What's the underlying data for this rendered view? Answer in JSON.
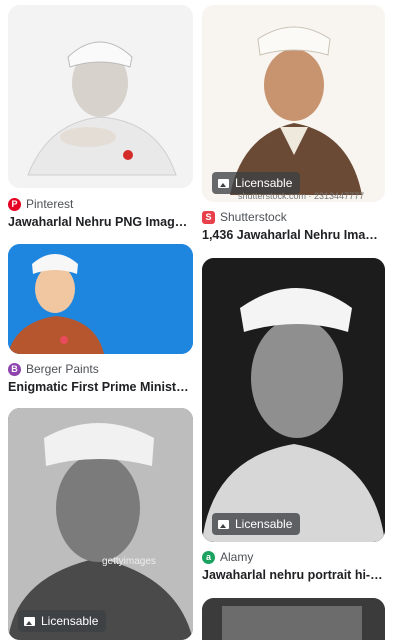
{
  "results": [
    {
      "source": "Pinterest",
      "title": "Jawaharlal Nehru PNG Images ...",
      "licensable": false,
      "source_icon": "pinterest-icon",
      "icon_color": "#e60023"
    },
    {
      "source": "Shutterstock",
      "title": "1,436 Jawaharlal Nehru Image...",
      "licensable": true,
      "badge": "Licensable",
      "watermark": "shutterstock.com · 2313447777",
      "source_icon": "shutterstock-icon",
      "icon_color": "#e8404a"
    },
    {
      "source": "Berger Paints",
      "title": "Enigmatic First Prime Minister ...",
      "licensable": false,
      "source_icon": "berger-paints-icon",
      "icon_color": "#8e44ad"
    },
    {
      "source": "Alamy",
      "title": "Jawaharlal nehru portrait hi-re...",
      "licensable": true,
      "badge": "Licensable",
      "source_icon": "alamy-icon",
      "icon_color": "#1aa260"
    },
    {
      "licensable": true,
      "badge": "Licensable",
      "watermark": "gettyimages"
    }
  ]
}
